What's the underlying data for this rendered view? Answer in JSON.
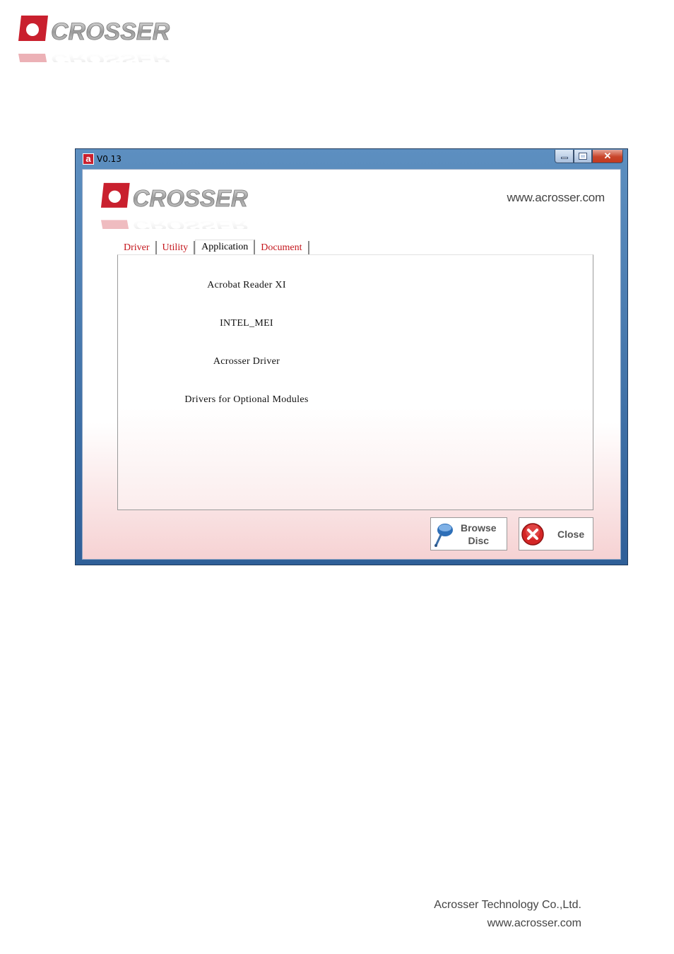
{
  "window": {
    "title": "V0.13",
    "app_icon_glyph": "a",
    "website": "www.acrosser.com"
  },
  "tabs": [
    {
      "label": "Driver",
      "active": false
    },
    {
      "label": "Utility",
      "active": false
    },
    {
      "label": "Application",
      "active": true
    },
    {
      "label": "Document",
      "active": false
    }
  ],
  "application_items": [
    "Acrobat Reader XI",
    "INTEL_MEI",
    "Acrosser Driver",
    "Drivers for Optional Modules"
  ],
  "buttons": {
    "browse_line1": "Browse",
    "browse_line2": "Disc",
    "close": "Close"
  },
  "footer": {
    "company": "Acrosser Technology Co.,Ltd.",
    "website": "www.acrosser.com"
  },
  "colors": {
    "brand_red": "#c4161c",
    "window_frame": "#2f5f98"
  },
  "icons": {
    "logo": "acrosser-logo",
    "browse": "disc-search-icon",
    "close": "close-circle-icon"
  }
}
